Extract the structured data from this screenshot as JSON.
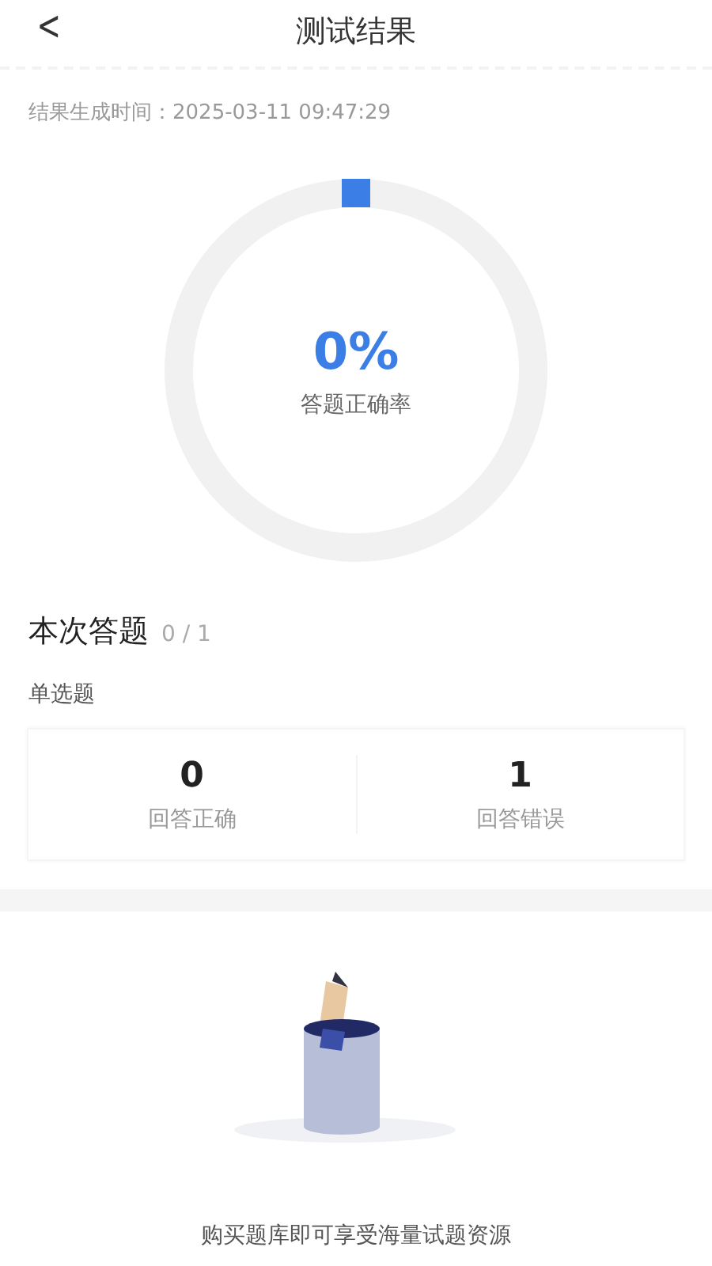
{
  "header": {
    "back": "<",
    "title": "测试结果"
  },
  "generated_time": "结果生成时间：2025-03-11 09:47:29",
  "accuracy": {
    "value": "0%",
    "label": "答题正确率"
  },
  "summary": {
    "title": "本次答题",
    "count": "0 / 1"
  },
  "section": {
    "title": "单选题",
    "stats": [
      {
        "value": "0",
        "label": "回答正确"
      },
      {
        "value": "1",
        "label": "回答错误"
      }
    ]
  },
  "promo": {
    "text": "购买题库即可享受海量试题资源"
  }
}
